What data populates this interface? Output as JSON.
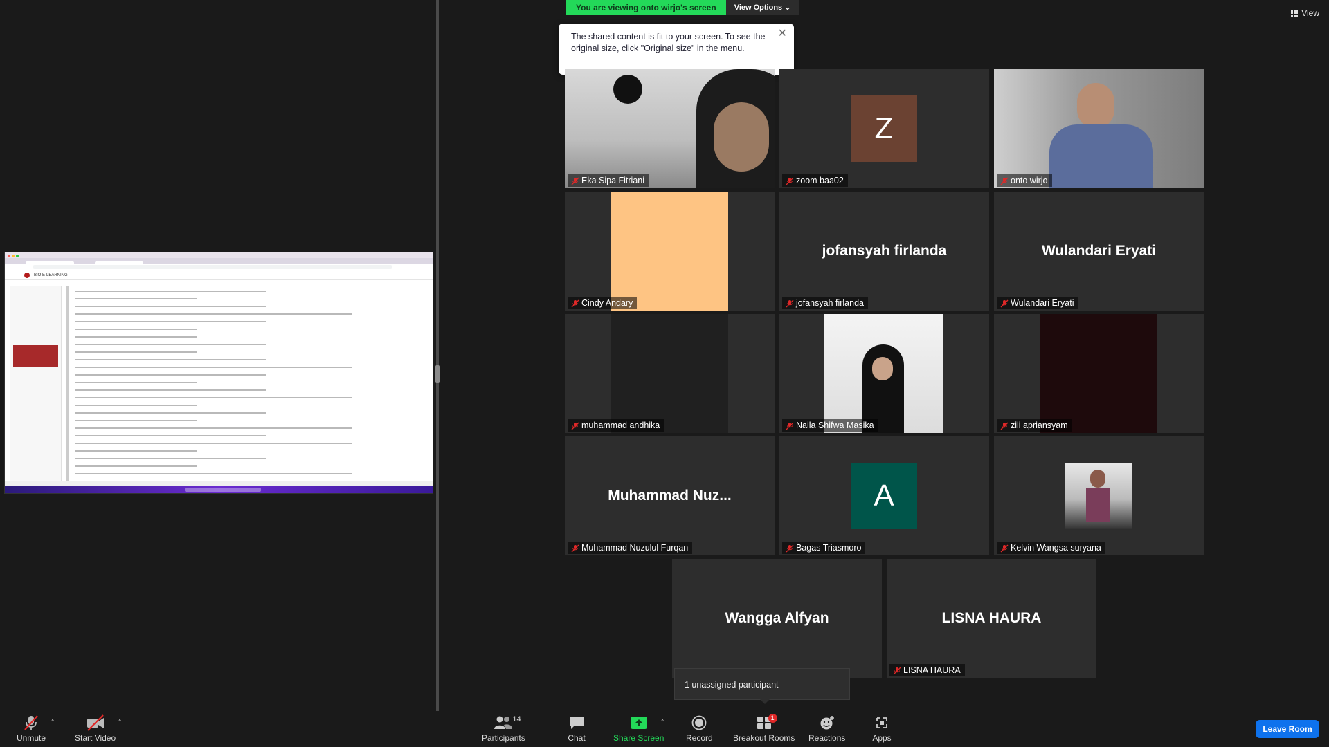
{
  "colors": {
    "banner_green": "#23d959",
    "active_speaker_border": "#e8f77a",
    "leave_blue": "#0e72ed",
    "muted_red": "#e02828"
  },
  "share_banner": {
    "viewing_text": "You are viewing onto wirjo's screen",
    "view_options_label": "View Options"
  },
  "view_button": {
    "label": "View",
    "icon": "grid-icon"
  },
  "tooltip": {
    "text": "The shared content is fit to your screen. To see the original size, click \"Original size\" in the menu."
  },
  "shared_screen": {
    "site_title": "BIO E-LEARNING"
  },
  "participants": [
    {
      "name": "Eka Sipa Fitriani",
      "kind": "video"
    },
    {
      "name": "zoom baa02",
      "kind": "avatar",
      "initial": "Z",
      "avatar_color": "#6b4232"
    },
    {
      "name": "onto wirjo",
      "kind": "video",
      "active_speaker": true
    },
    {
      "name": "Cindy Andary",
      "kind": "color",
      "fill_color": "#fec483"
    },
    {
      "name": "jofansyah firlanda",
      "kind": "name",
      "display_name": "jofansyah firlanda"
    },
    {
      "name": "Wulandari Eryati",
      "kind": "name",
      "display_name": "Wulandari Eryati"
    },
    {
      "name": "muhammad andhika",
      "kind": "dark"
    },
    {
      "name": "Naila Shifwa Masika",
      "kind": "video"
    },
    {
      "name": "zili apriansyam",
      "kind": "dark-red"
    },
    {
      "name": "Muhammad Nuzulul Furqan",
      "kind": "name",
      "display_name": "Muhammad  Nuz..."
    },
    {
      "name": "Bagas Triasmoro",
      "kind": "avatar",
      "initial": "A",
      "avatar_color": "#00554a"
    },
    {
      "name": "Kelvin Wangsa suryana",
      "kind": "photo"
    },
    {
      "name": "",
      "kind": "name",
      "display_name": "Wangga Alfyan"
    },
    {
      "name": "LISNA HAURA",
      "kind": "name",
      "display_name": "LISNA HAURA"
    }
  ],
  "toast": {
    "text": "1 unassigned participant"
  },
  "toolbar": {
    "unmute": "Unmute",
    "start_video": "Start Video",
    "participants": "Participants",
    "participant_count": "14",
    "chat": "Chat",
    "share_screen": "Share Screen",
    "record": "Record",
    "breakout_rooms": "Breakout Rooms",
    "breakout_badge": "1",
    "reactions": "Reactions",
    "apps": "Apps",
    "leave_room": "Leave Room"
  }
}
